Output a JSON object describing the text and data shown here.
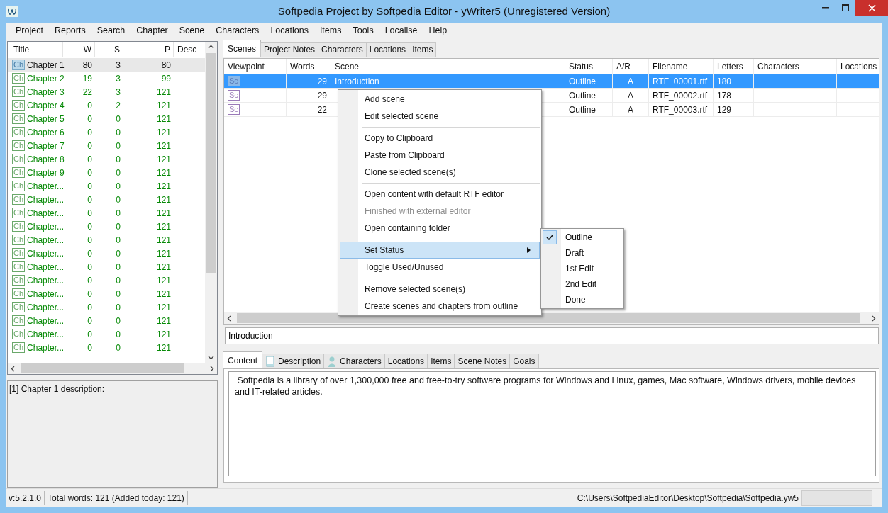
{
  "window": {
    "title": "Softpedia Project by Softpedia Editor - yWriter5 (Unregistered Version)"
  },
  "menu_bar": [
    "Project",
    "Reports",
    "Search",
    "Chapter",
    "Scene",
    "Characters",
    "Locations",
    "Items",
    "Tools",
    "Localise",
    "Help"
  ],
  "chapter_list": {
    "columns": [
      "Title",
      "W",
      "S",
      "P",
      "Desc"
    ],
    "rows": [
      {
        "icon": "Ch",
        "title": "Chapter 1",
        "w": "80",
        "s": "3",
        "p": "80",
        "selected": true
      },
      {
        "icon": "Ch",
        "title": "Chapter 2",
        "w": "19",
        "s": "3",
        "p": "99",
        "selected": false
      },
      {
        "icon": "Ch",
        "title": "Chapter 3",
        "w": "22",
        "s": "3",
        "p": "121",
        "selected": false
      },
      {
        "icon": "Ch",
        "title": "Chapter 4",
        "w": "0",
        "s": "2",
        "p": "121",
        "selected": false
      },
      {
        "icon": "Ch",
        "title": "Chapter 5",
        "w": "0",
        "s": "0",
        "p": "121",
        "selected": false
      },
      {
        "icon": "Ch",
        "title": "Chapter 6",
        "w": "0",
        "s": "0",
        "p": "121",
        "selected": false
      },
      {
        "icon": "Ch",
        "title": "Chapter 7",
        "w": "0",
        "s": "0",
        "p": "121",
        "selected": false
      },
      {
        "icon": "Ch",
        "title": "Chapter 8",
        "w": "0",
        "s": "0",
        "p": "121",
        "selected": false
      },
      {
        "icon": "Ch",
        "title": "Chapter 9",
        "w": "0",
        "s": "0",
        "p": "121",
        "selected": false
      },
      {
        "icon": "Ch",
        "title": "Chapter...",
        "w": "0",
        "s": "0",
        "p": "121",
        "selected": false
      },
      {
        "icon": "Ch",
        "title": "Chapter...",
        "w": "0",
        "s": "0",
        "p": "121",
        "selected": false
      },
      {
        "icon": "Ch",
        "title": "Chapter...",
        "w": "0",
        "s": "0",
        "p": "121",
        "selected": false
      },
      {
        "icon": "Ch",
        "title": "Chapter...",
        "w": "0",
        "s": "0",
        "p": "121",
        "selected": false
      },
      {
        "icon": "Ch",
        "title": "Chapter...",
        "w": "0",
        "s": "0",
        "p": "121",
        "selected": false
      },
      {
        "icon": "Ch",
        "title": "Chapter...",
        "w": "0",
        "s": "0",
        "p": "121",
        "selected": false
      },
      {
        "icon": "Ch",
        "title": "Chapter...",
        "w": "0",
        "s": "0",
        "p": "121",
        "selected": false
      },
      {
        "icon": "Ch",
        "title": "Chapter...",
        "w": "0",
        "s": "0",
        "p": "121",
        "selected": false
      },
      {
        "icon": "Ch",
        "title": "Chapter...",
        "w": "0",
        "s": "0",
        "p": "121",
        "selected": false
      },
      {
        "icon": "Ch",
        "title": "Chapter...",
        "w": "0",
        "s": "0",
        "p": "121",
        "selected": false
      },
      {
        "icon": "Ch",
        "title": "Chapter...",
        "w": "0",
        "s": "0",
        "p": "121",
        "selected": false
      },
      {
        "icon": "Ch",
        "title": "Chapter...",
        "w": "0",
        "s": "0",
        "p": "121",
        "selected": false
      },
      {
        "icon": "Ch",
        "title": "Chapter...",
        "w": "0",
        "s": "0",
        "p": "121",
        "selected": false
      }
    ]
  },
  "chapter_description": "[1] Chapter 1 description:",
  "top_tabs": [
    {
      "label": "Scenes",
      "selected": true
    },
    {
      "label": "Project Notes",
      "selected": false
    },
    {
      "label": "Characters",
      "selected": false
    },
    {
      "label": "Locations",
      "selected": false
    },
    {
      "label": "Items",
      "selected": false
    }
  ],
  "scene_grid": {
    "columns": [
      "Viewpoint",
      "Words",
      "Scene",
      "Status",
      "A/R",
      "Filename",
      "Letters",
      "Characters",
      "Locations"
    ],
    "rows": [
      {
        "icon": "Sc",
        "words": "29",
        "scene": "Introduction",
        "status": "Outline",
        "ar": "A",
        "filename": "RTF_00001.rtf",
        "letters": "180",
        "selected": true
      },
      {
        "icon": "Sc",
        "words": "29",
        "scene": "",
        "status": "Outline",
        "ar": "A",
        "filename": "RTF_00002.rtf",
        "letters": "178",
        "selected": false
      },
      {
        "icon": "Sc",
        "words": "22",
        "scene": "",
        "status": "Outline",
        "ar": "A",
        "filename": "RTF_00003.rtf",
        "letters": "129",
        "selected": false
      }
    ]
  },
  "context_menu": {
    "groups": [
      [
        {
          "label": "Add scene",
          "disabled": false,
          "selected": false,
          "submenu": false
        },
        {
          "label": "Edit selected scene",
          "disabled": false,
          "selected": false,
          "submenu": false
        }
      ],
      [
        {
          "label": "Copy to Clipboard",
          "disabled": false,
          "selected": false,
          "submenu": false
        },
        {
          "label": "Paste from Clipboard",
          "disabled": false,
          "selected": false,
          "submenu": false
        },
        {
          "label": "Clone selected scene(s)",
          "disabled": false,
          "selected": false,
          "submenu": false
        }
      ],
      [
        {
          "label": "Open content with default RTF editor",
          "disabled": false,
          "selected": false,
          "submenu": false
        },
        {
          "label": "Finished with external editor",
          "disabled": true,
          "selected": false,
          "submenu": false
        },
        {
          "label": "Open containing folder",
          "disabled": false,
          "selected": false,
          "submenu": false
        }
      ],
      [
        {
          "label": "Set Status",
          "disabled": false,
          "selected": true,
          "submenu": true
        },
        {
          "label": "Toggle Used/Unused",
          "disabled": false,
          "selected": false,
          "submenu": false
        }
      ],
      [
        {
          "label": "Remove selected scene(s)",
          "disabled": false,
          "selected": false,
          "submenu": false
        },
        {
          "label": "Create scenes and chapters from outline",
          "disabled": false,
          "selected": false,
          "submenu": false
        }
      ]
    ]
  },
  "status_submenu": [
    {
      "label": "Outline",
      "checked": true
    },
    {
      "label": "Draft",
      "checked": false
    },
    {
      "label": "1st Edit",
      "checked": false
    },
    {
      "label": "2nd Edit",
      "checked": false
    },
    {
      "label": "Done",
      "checked": false
    }
  ],
  "scene_title_field": {
    "value": "Introduction"
  },
  "bottom_tabs": [
    {
      "label": "Content",
      "kind": "plain",
      "selected": true
    },
    {
      "label": "Description",
      "kind": "page",
      "selected": false
    },
    {
      "label": "Characters",
      "kind": "person",
      "selected": false
    },
    {
      "label": "Locations",
      "kind": "plain",
      "selected": false
    },
    {
      "label": "Items",
      "kind": "plain",
      "selected": false
    },
    {
      "label": "Scene Notes",
      "kind": "plain",
      "selected": false
    },
    {
      "label": "Goals",
      "kind": "plain",
      "selected": false
    }
  ],
  "content_text": " Softpedia is a library of over 1,300,000 free and free-to-try software programs for Windows and Linux, games, Mac software, Windows drivers, mobile devices and IT-related articles.",
  "status_bar": {
    "version": "v:5.2.1.0",
    "total_words": "Total words: 121 (Added today: 121)",
    "path": "C:\\Users\\SoftpediaEditor\\Desktop\\Softpedia\\Softpedia.yw5"
  }
}
